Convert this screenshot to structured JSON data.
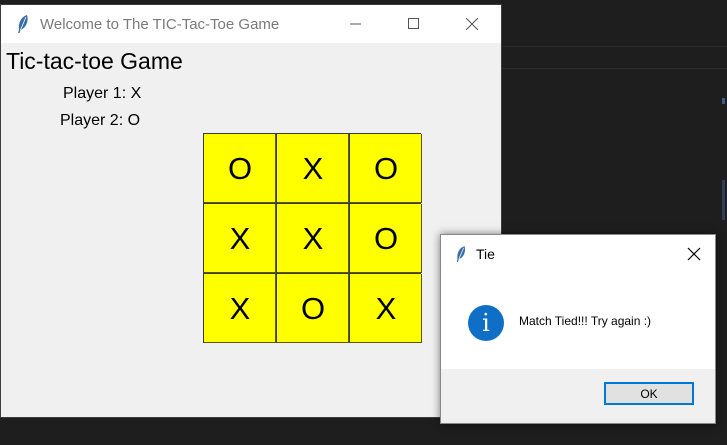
{
  "main_window": {
    "title": "Welcome to The TIC-Tac-Toe Game",
    "game_title": "Tic-tac-toe Game",
    "player1": "Player 1: X",
    "player2": "Player 2: O",
    "board": [
      "O",
      "X",
      "O",
      "X",
      "X",
      "O",
      "X",
      "O",
      "X"
    ],
    "cell_color": "#ffff00"
  },
  "dialog": {
    "title": "Tie",
    "message": "Match Tied!!!  Try again :)",
    "icon_glyph": "i",
    "ok_label": "OK",
    "accent": "#0078d7",
    "icon_color": "#0f6fc6"
  }
}
